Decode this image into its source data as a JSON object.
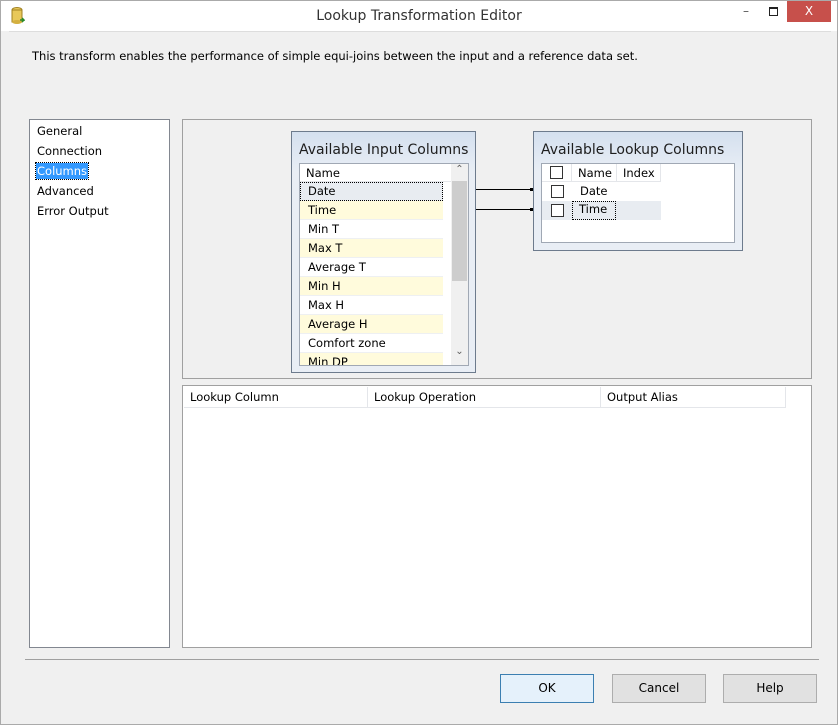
{
  "window": {
    "title": "Lookup Transformation Editor",
    "close_label": "X",
    "minimize_label": "–"
  },
  "description": "This transform enables the performance of simple equi-joins between the input and a reference data set.",
  "nav": {
    "items": [
      {
        "label": "General"
      },
      {
        "label": "Connection"
      },
      {
        "label": "Columns",
        "selected": true
      },
      {
        "label": "Advanced"
      },
      {
        "label": "Error Output"
      }
    ]
  },
  "input_columns": {
    "title": "Available Input Columns",
    "header": "Name",
    "rows": [
      "Date",
      "Time",
      "Min T",
      "Max T",
      "Average T",
      "Min H",
      "Max H",
      "Average H",
      "Comfort zone",
      "Min DP"
    ],
    "selected": "Date",
    "scroll_up": "⌃",
    "scroll_down": "⌄"
  },
  "lookup_columns": {
    "title": "Available Lookup Columns",
    "headers": {
      "name": "Name",
      "index": "Index"
    },
    "rows": [
      {
        "name": "Date",
        "index": "",
        "checked": false
      },
      {
        "name": "Time",
        "index": "",
        "checked": false
      }
    ],
    "selected": "Time"
  },
  "mappings": [
    {
      "input": "Date",
      "lookup": "Date"
    },
    {
      "input": "Time",
      "lookup": "Time"
    }
  ],
  "grid": {
    "headers": [
      "Lookup Column",
      "Lookup Operation",
      "Output Alias"
    ]
  },
  "buttons": {
    "ok": "OK",
    "cancel": "Cancel",
    "help": "Help"
  }
}
